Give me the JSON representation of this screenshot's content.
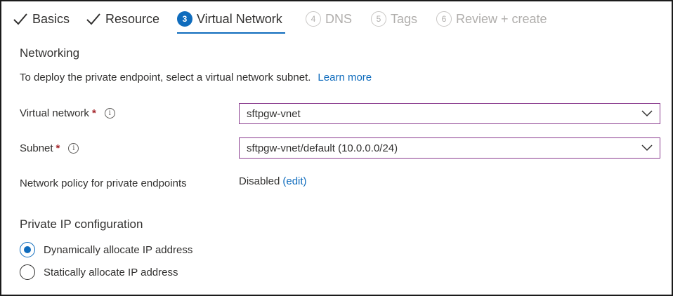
{
  "tabs": [
    {
      "label": "Basics",
      "state": "done"
    },
    {
      "label": "Resource",
      "state": "done"
    },
    {
      "label": "Virtual Network",
      "state": "active",
      "number": "3"
    },
    {
      "label": "DNS",
      "state": "disabled",
      "number": "4"
    },
    {
      "label": "Tags",
      "state": "disabled",
      "number": "5"
    },
    {
      "label": "Review + create",
      "state": "disabled",
      "number": "6"
    }
  ],
  "networking": {
    "title": "Networking",
    "description": "To deploy the private endpoint, select a virtual network subnet.",
    "learn_more": "Learn more"
  },
  "fields": {
    "virtual_network": {
      "label": "Virtual network",
      "required": "*",
      "value": "sftpgw-vnet"
    },
    "subnet": {
      "label": "Subnet",
      "required": "*",
      "value": "sftpgw-vnet/default (10.0.0.0/24)"
    },
    "policy": {
      "label": "Network policy for private endpoints",
      "value": "Disabled",
      "edit": "(edit)"
    }
  },
  "ip_config": {
    "title": "Private IP configuration",
    "options": [
      {
        "label": "Dynamically allocate IP address",
        "checked": true
      },
      {
        "label": "Statically allocate IP address",
        "checked": false
      }
    ]
  },
  "colors": {
    "accent": "#0f6cbd",
    "required": "#a4262c",
    "select_border": "#8a3d8f"
  },
  "icons": {
    "info": "i"
  }
}
